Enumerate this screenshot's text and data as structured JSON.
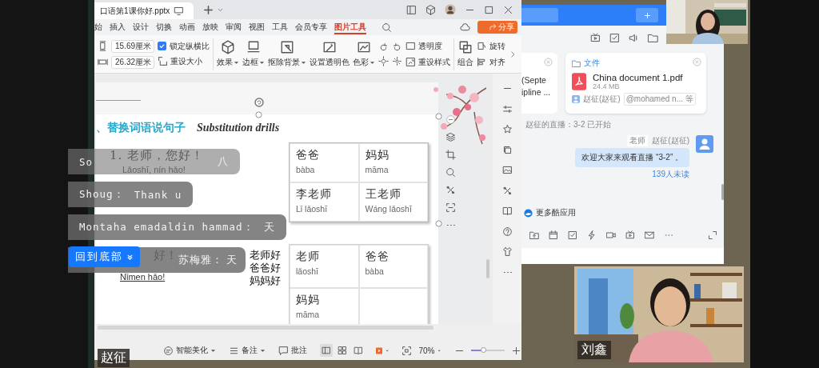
{
  "wps": {
    "file_tab": "口语第1课你好.pptx",
    "menu": [
      {
        "label": "始",
        "selected": false
      },
      {
        "label": "插入",
        "selected": false
      },
      {
        "label": "设计",
        "selected": false
      },
      {
        "label": "切换",
        "selected": false
      },
      {
        "label": "动画",
        "selected": false
      },
      {
        "label": "放映",
        "selected": false
      },
      {
        "label": "审阅",
        "selected": false
      },
      {
        "label": "视图",
        "selected": false
      },
      {
        "label": "工具",
        "selected": false
      },
      {
        "label": "会员专享",
        "selected": false
      },
      {
        "label": "图片工具",
        "selected": true
      }
    ],
    "share": "分享",
    "ribbon": {
      "height_value": "15.69厘米",
      "width_value": "26.32厘米",
      "lock_ratio": {
        "label": "锁定纵横比",
        "checked": true
      },
      "reset_size": "重设大小",
      "tools": [
        {
          "kind": "effects",
          "label": "效果",
          "dropdown": true
        },
        {
          "kind": "border",
          "label": "边框",
          "dropdown": true
        },
        {
          "kind": "remove-bg",
          "label": "抠除背景",
          "dropdown": true
        },
        {
          "kind": "transparent-color",
          "label": "设置透明色",
          "dropdown": false
        },
        {
          "kind": "color",
          "label": "色彩",
          "dropdown": true
        }
      ],
      "transparency": "透明度",
      "reset_style": "重设样式",
      "group": "组合",
      "rotate": "旋转",
      "align": "对齐"
    },
    "slide": {
      "heading": "、替换词语说句子",
      "heading_en": "Substitution drills",
      "sentences": [
        {
          "hanzi": "1. 老师，您好！",
          "pinyin": "Lǎoshī, nín hǎo!"
        },
        {
          "hanzi": "好！",
          "pinyin": "Nǐmen hǎo!"
        }
      ],
      "tables": [
        [
          {
            "hanzi": "爸爸",
            "pinyin": "bàba"
          },
          {
            "hanzi": "妈妈",
            "pinyin": "māma"
          },
          {
            "hanzi": "李老师",
            "pinyin": "Lǐ lǎoshī"
          },
          {
            "hanzi": "王老师",
            "pinyin": "Wáng lǎoshī"
          }
        ],
        [
          {
            "hanzi": "老师",
            "pinyin": "lǎoshī"
          },
          {
            "hanzi": "爸爸",
            "pinyin": "bàba"
          },
          {
            "hanzi": "妈妈",
            "pinyin": "māma"
          }
        ]
      ],
      "annotation": [
        "老师好",
        "爸爸好",
        "妈妈好"
      ]
    },
    "status_bar": {
      "beautify": "智能美化",
      "notes": "备注",
      "comments": "批注",
      "views": [
        {
          "kind": "normal",
          "selected": true
        },
        {
          "kind": "sorter",
          "selected": false
        },
        {
          "kind": "reading",
          "selected": false
        }
      ],
      "zoom": "70%",
      "zoom_slider": {
        "level": 0.35
      }
    }
  },
  "chat": {
    "partial_card": {
      "lines": [
        "(Septe",
        "ipline ..."
      ]
    },
    "file_card": {
      "folder": "文件",
      "file": "China document 1.pdf",
      "size": "24.4 MB",
      "sender": "赵征(赵征)",
      "mentions": "@mohamed n... 等"
    },
    "live_notice": "赵征的直播：3-2 已开始",
    "message": {
      "role": "老师",
      "sender": "赵征(赵征)",
      "text": "欢迎大家来观看直播 “3-2” 。",
      "unread": "139人未读"
    },
    "more_apps": "更多酷应用"
  },
  "live_comments": [
    {
      "author": "So",
      "message": "八",
      "faded": true
    },
    {
      "author": "Shoug：",
      "message": "Thank u",
      "faded": false
    },
    {
      "author": "Montaha emadaldin hammad：",
      "message": "天",
      "faded": false
    },
    {
      "author": "苏梅雅：",
      "message": "天",
      "faded": false
    }
  ],
  "back_to_bottom": "回到底部",
  "screen_share_label": "赵征",
  "webcam_label": "刘鑫"
}
